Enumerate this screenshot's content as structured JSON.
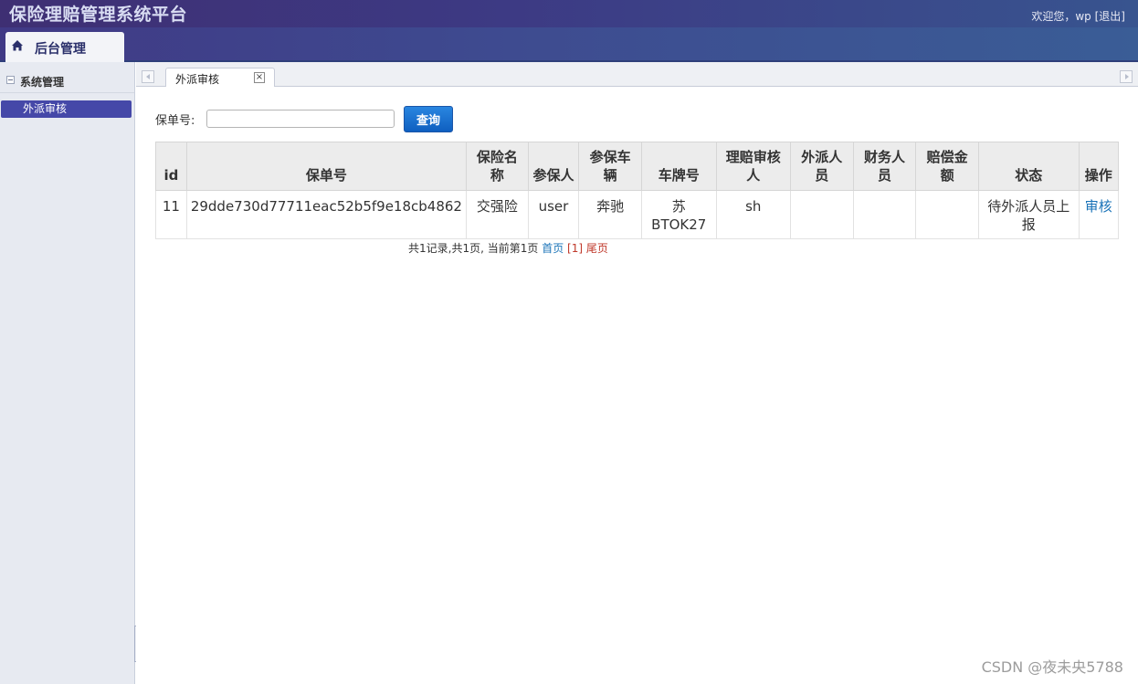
{
  "header": {
    "title": "保险理赔管理系统平台",
    "welcome_text": "欢迎您，wp",
    "logout_label": "[退出]"
  },
  "nav": {
    "home_label": "后台管理"
  },
  "sidebar": {
    "group_label": "系统管理",
    "items": [
      {
        "label": "外派审核"
      }
    ]
  },
  "tabs": [
    {
      "label": "外派审核"
    }
  ],
  "search": {
    "label": "保单号:",
    "value": "",
    "button_label": "查询"
  },
  "table": {
    "columns": [
      "id",
      "保单号",
      "保险名称",
      "参保人",
      "参保车辆",
      "车牌号",
      "理赔审核人",
      "外派人员",
      "财务人员",
      "赔偿金额",
      "状态",
      "操作"
    ],
    "rows": [
      {
        "id": "11",
        "policy_no": "29dde730d77711eac52b5f9e18cb4862",
        "insurance_name": "交强险",
        "insured": "user",
        "vehicle": "奔驰",
        "plate": "苏BTOK27",
        "reviewer": "sh",
        "field_staff": "",
        "finance_staff": "",
        "amount": "",
        "status": "待外派人员上报",
        "action": "审核"
      }
    ]
  },
  "pager": {
    "summary": "共1记录,共1页, 当前第1页",
    "first_label": "首页",
    "current_label": "[1]",
    "last_label": "尾页"
  },
  "watermark": "CSDN @夜未央5788",
  "colors": {
    "header_bg": "#3e2f73",
    "sidebar_active": "#4548a8",
    "button_blue": "#0f5fc0",
    "link_blue": "#1a73b8"
  }
}
